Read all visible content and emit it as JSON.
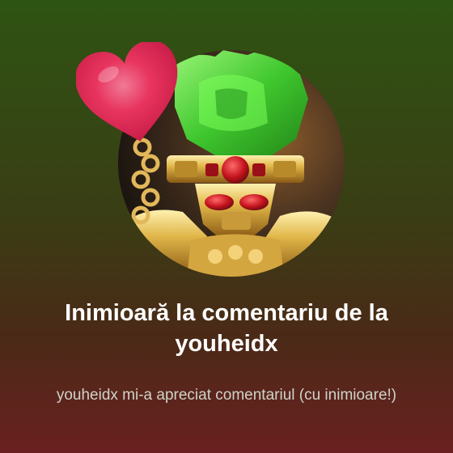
{
  "notification": {
    "title": "Inimioară la comentariu de la youheidx",
    "message": "youheidx mi-a apreciat comentariul (cu inimioare!)",
    "badge_icon": "heart-icon",
    "avatar": "user-avatar"
  },
  "colors": {
    "heart": "#e8355f",
    "background_top": "#2e5413",
    "background_bottom": "#6a2020"
  }
}
